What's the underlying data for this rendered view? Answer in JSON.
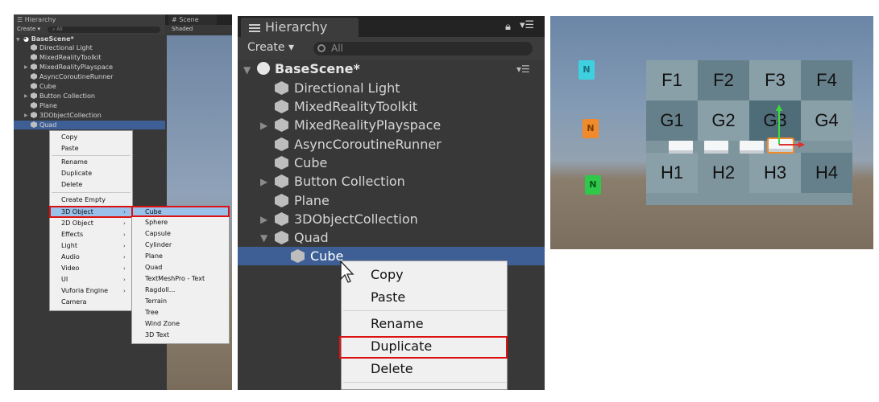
{
  "panel1": {
    "tabs": {
      "hierarchy": "Hierarchy",
      "scene": "Scene"
    },
    "toolbar": {
      "create": "Create",
      "search_placeholder": "All",
      "shaded": "Shaded"
    },
    "scene_name": "BaseScene*",
    "items": [
      "Directional Light",
      "MixedRealityToolkit",
      "MixedRealityPlayspace",
      "AsyncCoroutineRunner",
      "Cube",
      "Button Collection",
      "Plane",
      "3DObjectCollection",
      "Quad"
    ],
    "context_menu": [
      "Copy",
      "Paste",
      "Rename",
      "Duplicate",
      "Delete",
      "Create Empty",
      "3D Object",
      "2D Object",
      "Effects",
      "Light",
      "Audio",
      "Video",
      "UI",
      "Vuforia Engine",
      "Camera"
    ],
    "submenu_3d": [
      "Cube",
      "Sphere",
      "Capsule",
      "Cylinder",
      "Plane",
      "Quad",
      "TextMeshPro - Text",
      "Ragdoll...",
      "Terrain",
      "Tree",
      "Wind Zone",
      "3D Text"
    ]
  },
  "panel2": {
    "tab": "Hierarchy",
    "toolbar": {
      "create": "Create",
      "search_placeholder": "All"
    },
    "scene_name": "BaseScene*",
    "items": [
      "Directional Light",
      "MixedRealityToolkit",
      "MixedRealityPlayspace",
      "AsyncCoroutineRunner",
      "Cube",
      "Button Collection",
      "Plane",
      "3DObjectCollection",
      "Quad"
    ],
    "selected_child": "Cube",
    "context_menu": [
      "Copy",
      "Paste",
      "Rename",
      "Duplicate",
      "Delete"
    ]
  },
  "panel3": {
    "top_row": [
      "F1",
      "F2",
      "F3",
      "F4"
    ],
    "mid_row": [
      "G1",
      "G2",
      "G3",
      "G4"
    ],
    "bottom_row": [
      "H1",
      "H2",
      "H3",
      "H4"
    ],
    "colors": {
      "cyan_icon": "#3fd0e0",
      "orange_icon": "#f08a2a",
      "green_icon": "#2fc84a",
      "board": "#7e959e",
      "highlight_red": "#dd1111"
    }
  }
}
